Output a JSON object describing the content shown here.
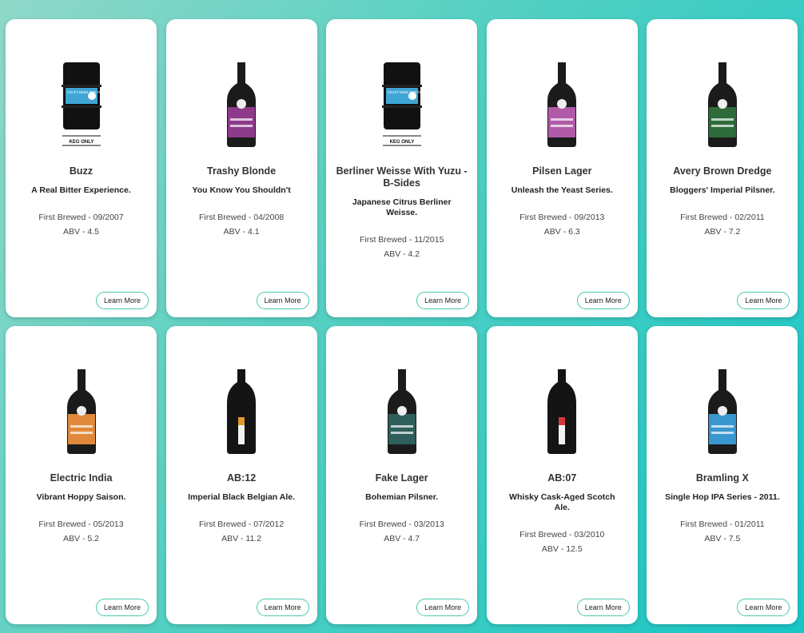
{
  "cards": [
    {
      "name": "Buzz",
      "tagline": "A Real Bitter Experience.",
      "first_brewed": "First Brewed - 09/2007",
      "abv": "ABV - 4.5",
      "image": "keg",
      "label_text": "CRAFT BEER FOR THE PEOPLE",
      "keg_only": "KEG ONLY",
      "label_color": "#3fa6d6",
      "button": "Learn More"
    },
    {
      "name": "Trashy Blonde",
      "tagline": "You Know You Shouldn't",
      "first_brewed": "First Brewed - 04/2008",
      "abv": "ABV - 4.1",
      "image": "bottle",
      "label_color": "#8e3a8a",
      "button": "Learn More"
    },
    {
      "name": "Berliner Weisse With Yuzu - B-Sides",
      "tagline": "Japanese Citrus Berliner Weisse.",
      "first_brewed": "First Brewed - 11/2015",
      "abv": "ABV - 4.2",
      "image": "keg",
      "label_text": "CRAFT BEER FOR THE PEOPLE",
      "keg_only": "KEG ONLY",
      "label_color": "#3fa6d6",
      "button": "Learn More"
    },
    {
      "name": "Pilsen Lager",
      "tagline": "Unleash the Yeast Series.",
      "first_brewed": "First Brewed - 09/2013",
      "abv": "ABV - 6.3",
      "image": "bottle",
      "label_color": "#b05aa8",
      "button": "Learn More"
    },
    {
      "name": "Avery Brown Dredge",
      "tagline": "Bloggers' Imperial Pilsner.",
      "first_brewed": "First Brewed - 02/2011",
      "abv": "ABV - 7.2",
      "image": "bottle",
      "label_color": "#2e6b3a",
      "button": "Learn More"
    },
    {
      "name": "Electric India",
      "tagline": "Vibrant Hoppy Saison.",
      "first_brewed": "First Brewed - 05/2013",
      "abv": "ABV - 5.2",
      "image": "bottle",
      "label_color": "#e0893a",
      "button": "Learn More"
    },
    {
      "name": "AB:12",
      "tagline": "Imperial Black Belgian Ale.",
      "first_brewed": "First Brewed - 07/2012",
      "abv": "ABV - 11.2",
      "image": "tall",
      "label_color": "#e09a2a",
      "button": "Learn More"
    },
    {
      "name": "Fake Lager",
      "tagline": "Bohemian Pilsner.",
      "first_brewed": "First Brewed - 03/2013",
      "abv": "ABV - 4.7",
      "image": "bottle",
      "label_color": "#2f5f5a",
      "button": "Learn More"
    },
    {
      "name": "AB:07",
      "tagline": "Whisky Cask-Aged Scotch Ale.",
      "first_brewed": "First Brewed - 03/2010",
      "abv": "ABV - 12.5",
      "image": "tall",
      "label_color": "#d23a3a",
      "button": "Learn More"
    },
    {
      "name": "Bramling X",
      "tagline": "Single Hop IPA Series - 2011.",
      "first_brewed": "First Brewed - 01/2011",
      "abv": "ABV - 7.5",
      "image": "bottle",
      "label_color": "#3a96cf",
      "button": "Learn More"
    }
  ]
}
